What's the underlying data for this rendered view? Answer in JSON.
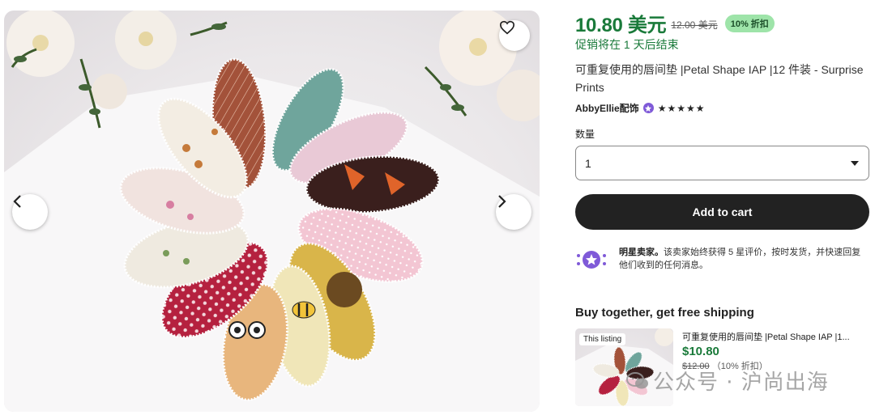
{
  "gallery": {
    "favorite_icon": "heart-outline-icon",
    "prev_icon": "chevron-left-icon",
    "next_icon": "chevron-right-icon"
  },
  "price": {
    "current": "10.80 美元",
    "original": "12.00 美元",
    "discount_badge": "10% 折扣",
    "sale_ends": "促销将在 1 天后结束"
  },
  "product": {
    "title": "可重复使用的唇间垫 |Petal Shape IAP |12 件装 - Surprise Prints"
  },
  "seller": {
    "name": "AbbyEllie配饰",
    "star_seller_icon": "star-seller-badge-icon",
    "stars": "★★★★★"
  },
  "quantity": {
    "label": "数量",
    "value": "1"
  },
  "cart": {
    "add_label": "Add to cart"
  },
  "star_seller": {
    "heading": "明星卖家。",
    "text": "该卖家始终获得 5 星评价，按时发货，并快速回复他们收到的任何消息。"
  },
  "bundle": {
    "title": "Buy together, get free shipping",
    "tag": "This listing",
    "item_name": "可重复使用的唇间垫 |Petal Shape IAP |1...",
    "item_price": "$10.80",
    "item_was": "$12.00",
    "item_discount": "（10% 折扣）"
  },
  "watermark": {
    "text": "公众号 · 沪尚出海"
  },
  "colors": {
    "sale_green": "#1a7a3a",
    "badge_green": "#9ee4a9",
    "button_dark": "#222222",
    "star_seller_purple": "#7f5ad8"
  }
}
